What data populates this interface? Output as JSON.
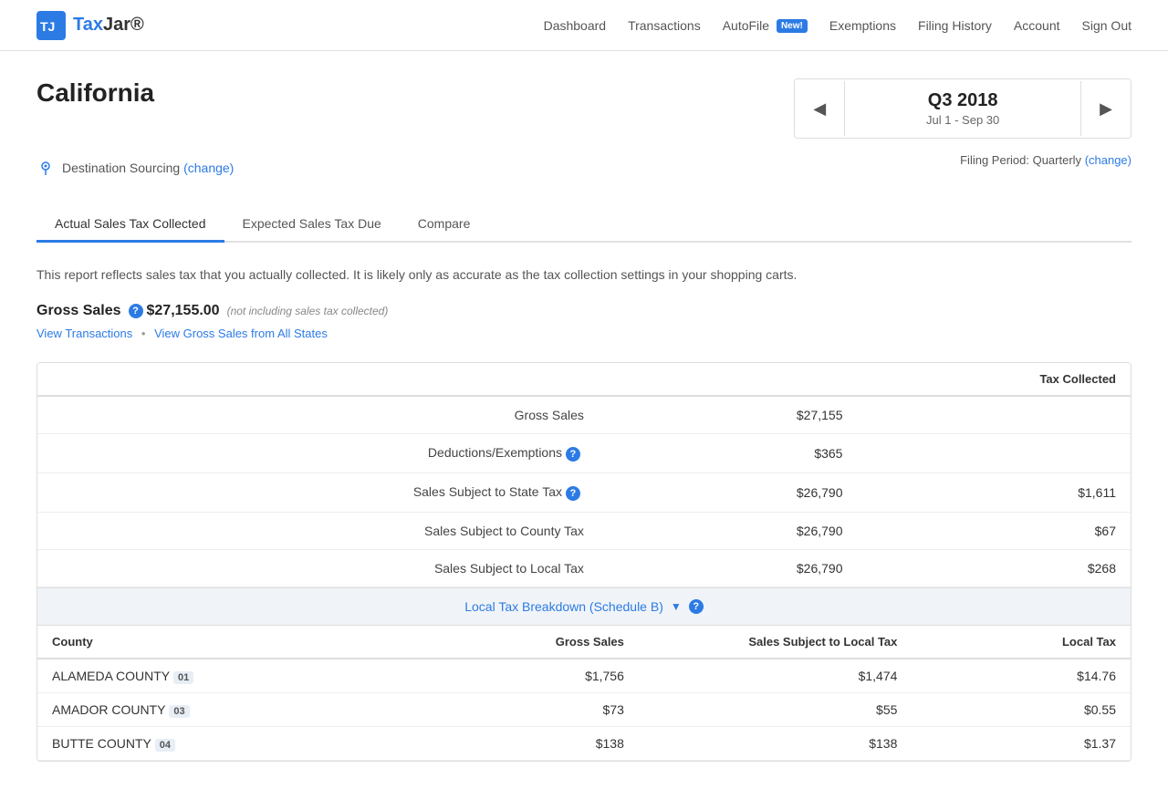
{
  "header": {
    "logo_text1": "Tax",
    "logo_text2": "Jar",
    "nav": {
      "dashboard": "Dashboard",
      "transactions": "Transactions",
      "autofile": "AutoFile",
      "autofile_badge": "New!",
      "exemptions": "Exemptions",
      "filing_history": "Filing History",
      "account": "Account",
      "sign_out": "Sign Out"
    }
  },
  "page": {
    "title": "California",
    "sourcing_label": "Destination Sourcing",
    "sourcing_change": "(change)",
    "filing_period_label": "Filing Period: Quarterly",
    "filing_period_change": "(change)",
    "quarter": {
      "label": "Q3 2018",
      "dates": "Jul 1 - Sep 30"
    },
    "tabs": [
      {
        "label": "Actual Sales Tax Collected",
        "active": true
      },
      {
        "label": "Expected Sales Tax Due",
        "active": false
      },
      {
        "label": "Compare",
        "active": false
      }
    ],
    "report_description": "This report reflects sales tax that you actually collected. It is likely only as accurate as the tax collection settings in your shopping carts.",
    "gross_sales_label": "Gross Sales",
    "gross_sales_amount": "$27,155.00",
    "gross_sales_note": "(not including sales tax collected)",
    "view_transactions": "View Transactions",
    "separator": "•",
    "view_gross_sales": "View Gross Sales from All States",
    "table": {
      "header_tax_collected": "Tax Collected",
      "rows": [
        {
          "label": "Gross Sales",
          "value": "$27,155",
          "tax": ""
        },
        {
          "label": "Deductions/Exemptions",
          "value": "$365",
          "tax": "",
          "has_info": true
        },
        {
          "label": "Sales Subject to State Tax",
          "value": "$26,790",
          "tax": "$1,611",
          "has_info": true
        },
        {
          "label": "Sales Subject to County Tax",
          "value": "$26,790",
          "tax": "$67"
        },
        {
          "label": "Sales Subject to Local Tax",
          "value": "$26,790",
          "tax": "$268"
        }
      ]
    },
    "local_breakdown_label": "Local Tax Breakdown (Schedule B)",
    "county_table": {
      "headers": [
        "County",
        "Gross Sales",
        "Sales Subject to Local Tax",
        "Local Tax"
      ],
      "rows": [
        {
          "county": "ALAMEDA COUNTY",
          "badge": "01",
          "gross": "$1,756",
          "subject": "$1,474",
          "tax": "$14.76"
        },
        {
          "county": "AMADOR COUNTY",
          "badge": "03",
          "gross": "$73",
          "subject": "$55",
          "tax": "$0.55"
        },
        {
          "county": "BUTTE COUNTY",
          "badge": "04",
          "gross": "$138",
          "subject": "$138",
          "tax": "$1.37"
        }
      ]
    }
  }
}
